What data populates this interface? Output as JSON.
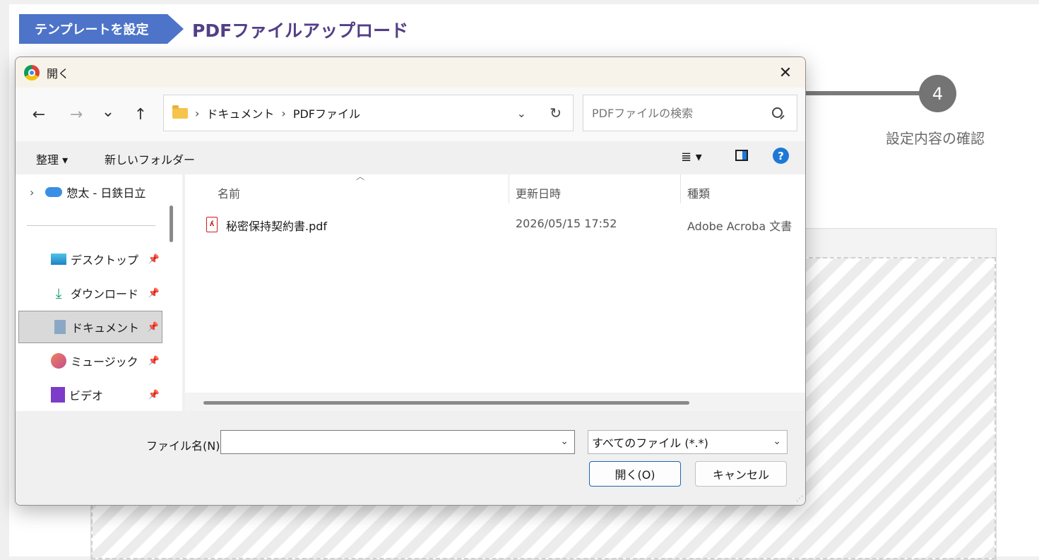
{
  "page": {
    "step_chip": "テンプレートを設定",
    "title": "PDFファイルアップロード",
    "step_number": "4",
    "step_caption": "設定内容の確認"
  },
  "dialog": {
    "title": "開く",
    "close": "✕",
    "nav": {
      "back": "←",
      "forward": "→",
      "recent": "⌄",
      "up": "↑"
    },
    "address": {
      "crumbs": [
        "ドキュメント",
        "PDFファイル"
      ],
      "separator": "›",
      "refresh": "↻"
    },
    "search": {
      "placeholder": "PDFファイルの検索"
    },
    "commands": {
      "organize": "整理 ▾",
      "new_folder": "新しいフォルダー",
      "view": "≣ ▾",
      "help": "?"
    },
    "sidebar": {
      "onedrive": "惣太 - 日鉄日立",
      "items": [
        {
          "label": "デスクトップ",
          "icon": "desktop-icon",
          "pin": "📌"
        },
        {
          "label": "ダウンロード",
          "icon": "download-icon",
          "pin": "📌"
        },
        {
          "label": "ドキュメント",
          "icon": "documents-icon",
          "pin": "📌",
          "selected": true
        },
        {
          "label": "ミュージック",
          "icon": "music-icon",
          "pin": "📌"
        },
        {
          "label": "ビデオ",
          "icon": "video-icon",
          "pin": "📌"
        }
      ]
    },
    "columns": {
      "name": "名前",
      "modified": "更新日時",
      "type": "種類"
    },
    "files": [
      {
        "name": "秘密保持契約書.pdf",
        "modified": "2026/05/15 17:52",
        "type": "Adobe Acroba 文書",
        "icon": "pdf-icon"
      }
    ],
    "footer": {
      "filename_label": "ファイル名(N):",
      "filename_value": "",
      "filetype": "すべてのファイル (*.*)",
      "open_button": "開く(O)",
      "cancel_button": "キャンセル"
    }
  },
  "colors": {
    "accent": "#4d74c9",
    "title": "#533f86",
    "dialog_primary": "#1f66b3"
  }
}
